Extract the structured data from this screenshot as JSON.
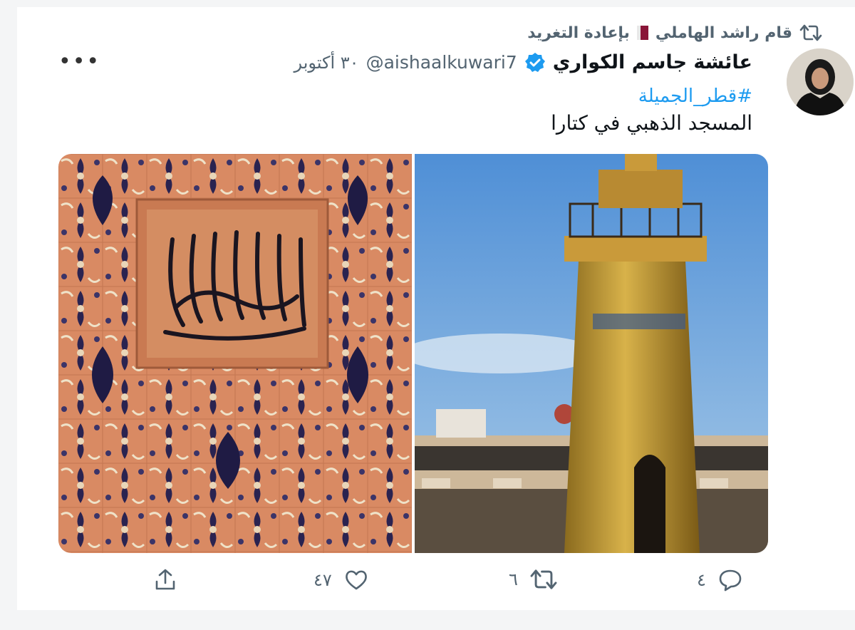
{
  "retweet": {
    "icon": "retweet-icon",
    "user": "قام راشد الهاملي",
    "flag": "qatar-flag-icon",
    "action": "بإعادة التغريد"
  },
  "tweet": {
    "display_name": "عائشة جاسم الكواري",
    "verified": true,
    "handle": "@aishaalkuwari7",
    "date": "٣٠ أكتوبر",
    "hashtag": "#قطر_الجميلة",
    "text": "المسجد الذهبي في كتارا",
    "images": [
      "calligraphy-tiles-image",
      "golden-minaret-image"
    ]
  },
  "actions": {
    "reply_count": "٤",
    "retweet_count": "٦",
    "like_count": "٤٧",
    "share_icon": "share-icon"
  },
  "colors": {
    "accent": "#1d9bf0",
    "secondary_text": "#536471",
    "primary_text": "#0f1419"
  }
}
